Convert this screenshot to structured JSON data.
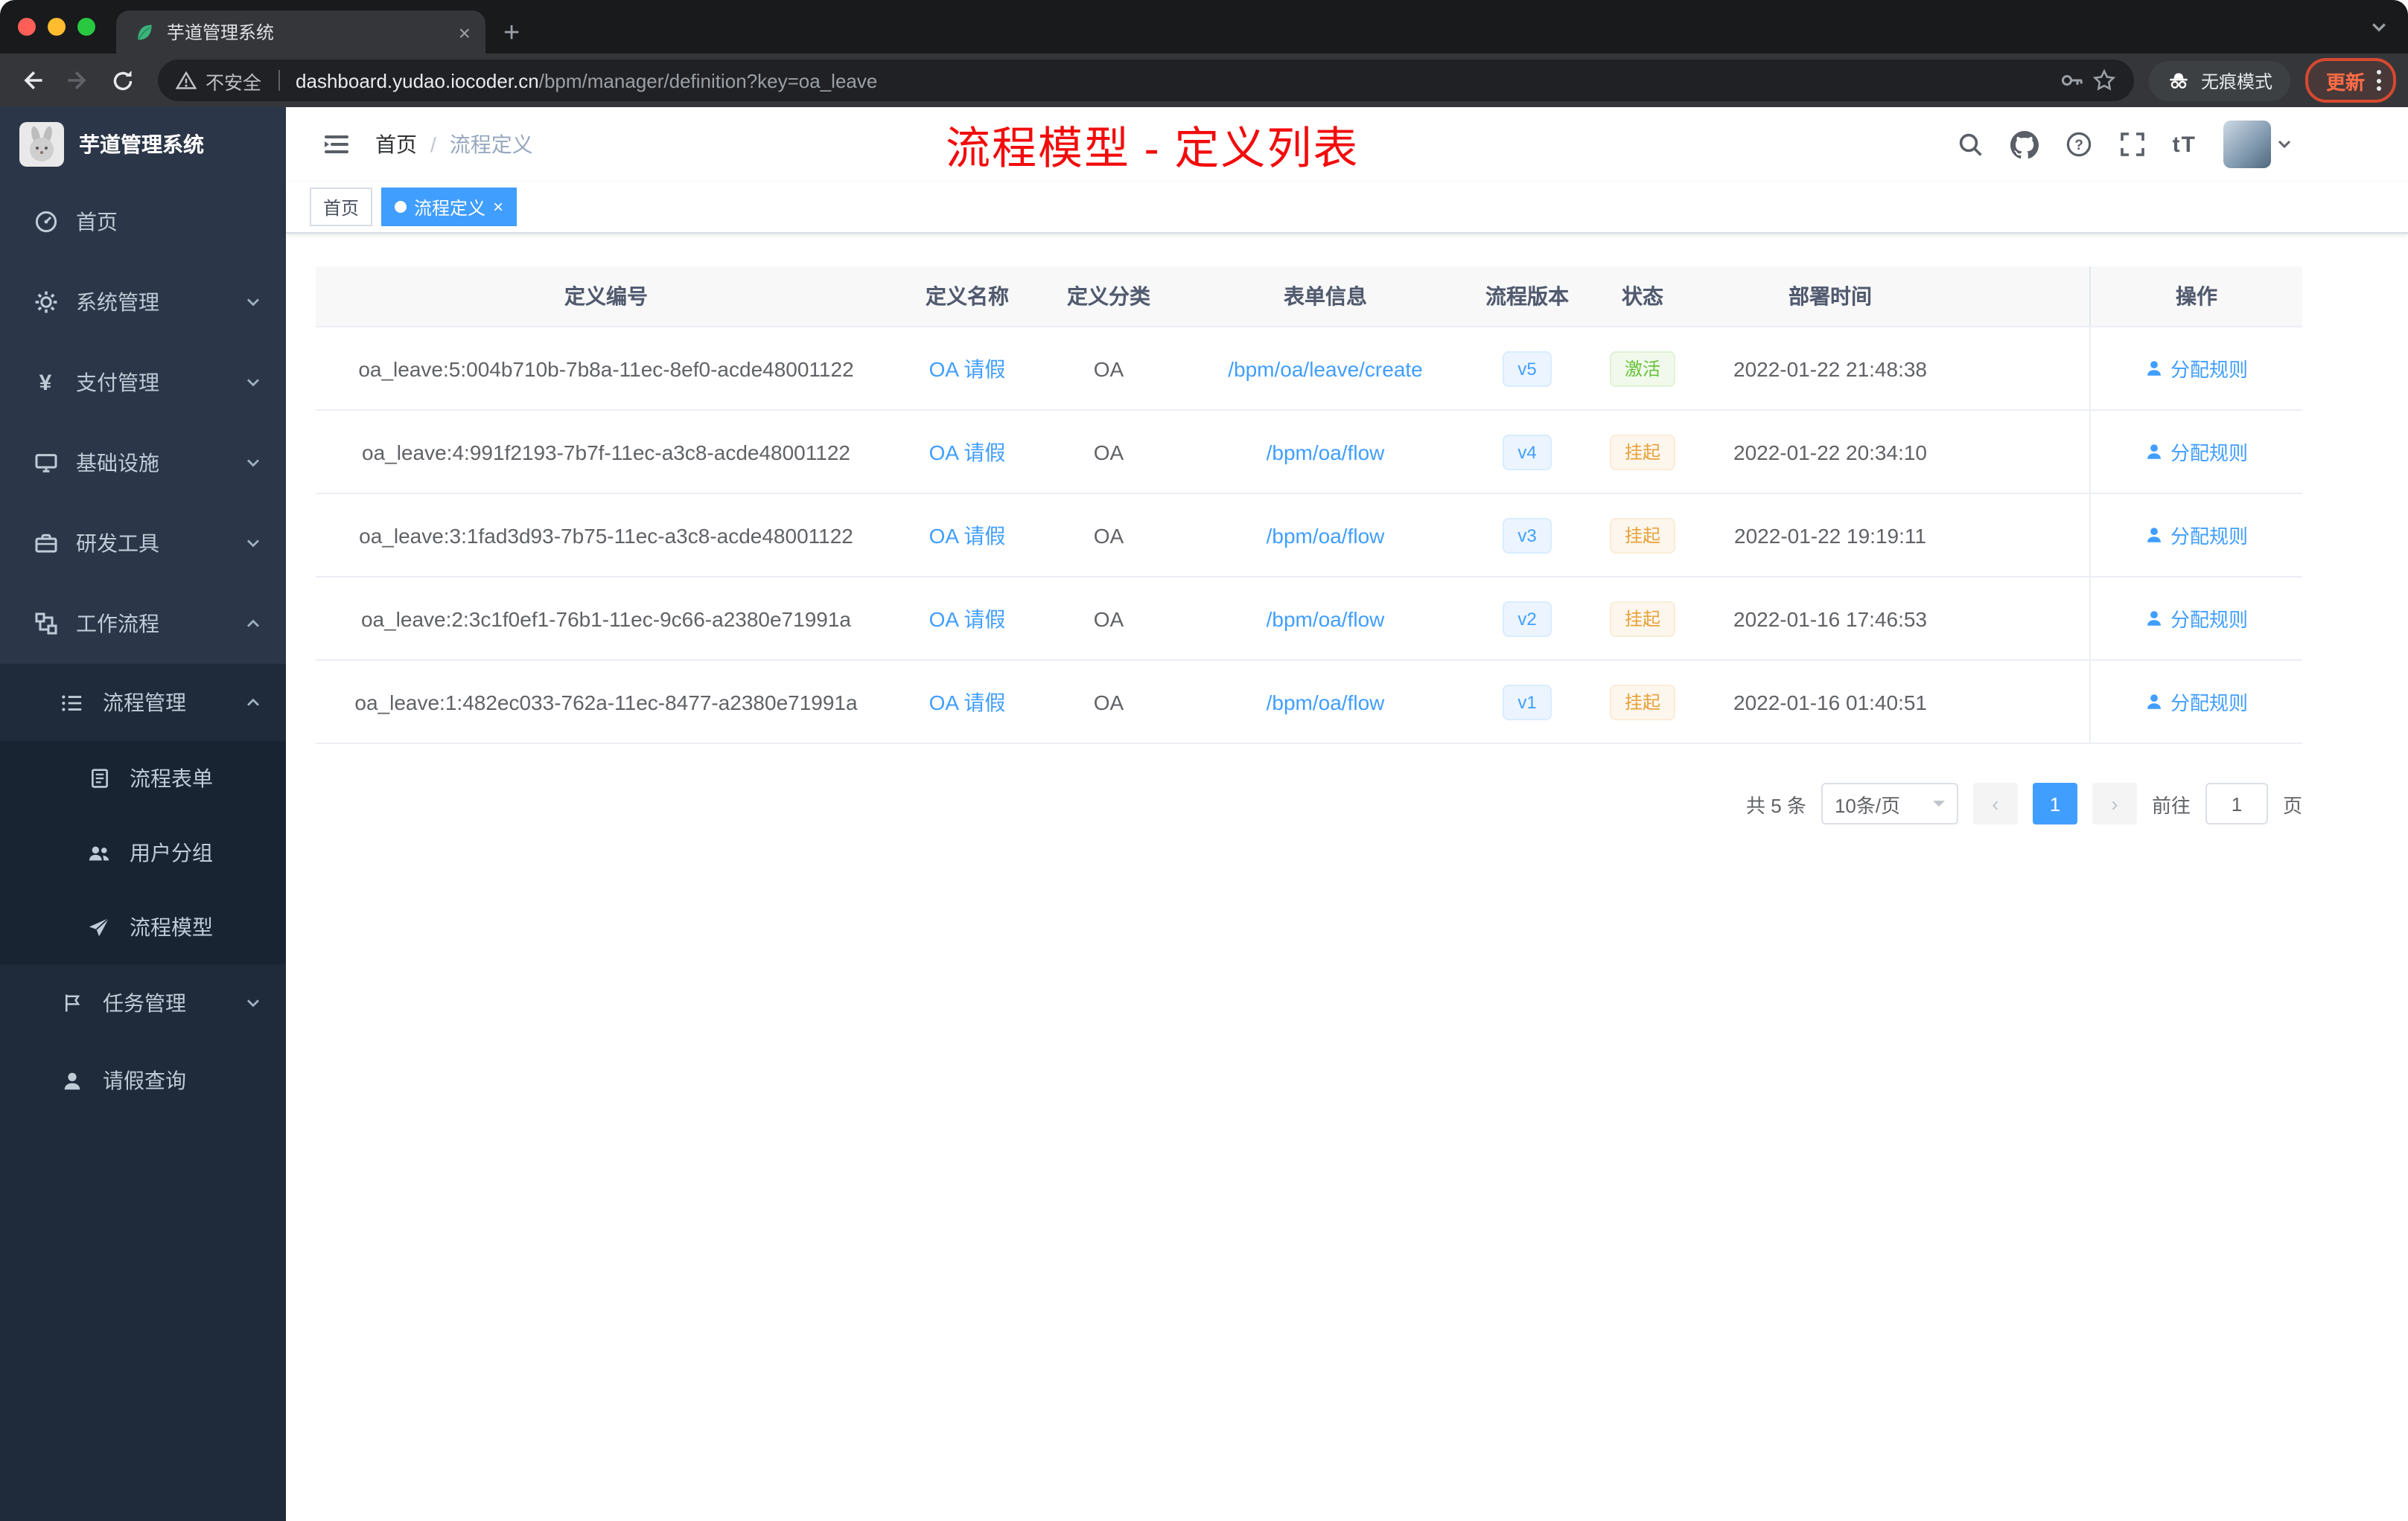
{
  "colors": {
    "primary": "#409eff",
    "annotation_red": "#f20c0c",
    "success_green": "#67c23a",
    "warning_orange": "#e6a23c",
    "sidebar_bg": "#2b3648"
  },
  "browser": {
    "tab_title": "芋道管理系统",
    "security": "不安全",
    "url_host": "dashboard.yudao.iocoder.cn",
    "url_path": "/bpm/manager/definition?key=oa_leave",
    "incognito": "无痕模式",
    "update": "更新"
  },
  "sidebar": {
    "title": "芋道管理系统",
    "menu": [
      {
        "label": "首页"
      },
      {
        "label": "系统管理"
      },
      {
        "label": "支付管理"
      },
      {
        "label": "基础设施"
      },
      {
        "label": "研发工具"
      },
      {
        "label": "工作流程"
      },
      {
        "label": "流程管理"
      },
      {
        "label": "流程表单"
      },
      {
        "label": "用户分组"
      },
      {
        "label": "流程模型"
      },
      {
        "label": "任务管理"
      },
      {
        "label": "请假查询"
      }
    ]
  },
  "navbar": {
    "breadcrumb_home": "首页",
    "breadcrumb_sep": "/",
    "breadcrumb_current": "流程定义",
    "annotation": "流程模型 - 定义列表"
  },
  "tags": {
    "items": [
      {
        "label": "首页"
      },
      {
        "label": "流程定义"
      }
    ]
  },
  "table": {
    "columns": [
      "定义编号",
      "定义名称",
      "定义分类",
      "表单信息",
      "流程版本",
      "状态",
      "部署时间",
      "操作"
    ],
    "rows": [
      {
        "id": "oa_leave:5:004b710b-7b8a-11ec-8ef0-acde48001122",
        "name": "OA 请假",
        "category": "OA",
        "form": "/bpm/oa/leave/create",
        "version": "v5",
        "status": "激活",
        "deployed": "2022-01-22 21:48:38",
        "action": "分配规则"
      },
      {
        "id": "oa_leave:4:991f2193-7b7f-11ec-a3c8-acde48001122",
        "name": "OA 请假",
        "category": "OA",
        "form": "/bpm/oa/flow",
        "version": "v4",
        "status": "挂起",
        "deployed": "2022-01-22 20:34:10",
        "action": "分配规则"
      },
      {
        "id": "oa_leave:3:1fad3d93-7b75-11ec-a3c8-acde48001122",
        "name": "OA 请假",
        "category": "OA",
        "form": "/bpm/oa/flow",
        "version": "v3",
        "status": "挂起",
        "deployed": "2022-01-22 19:19:11",
        "action": "分配规则"
      },
      {
        "id": "oa_leave:2:3c1f0ef1-76b1-11ec-9c66-a2380e71991a",
        "name": "OA 请假",
        "category": "OA",
        "form": "/bpm/oa/flow",
        "version": "v2",
        "status": "挂起",
        "deployed": "2022-01-16 17:46:53",
        "action": "分配规则"
      },
      {
        "id": "oa_leave:1:482ec033-762a-11ec-8477-a2380e71991a",
        "name": "OA 请假",
        "category": "OA",
        "form": "/bpm/oa/flow",
        "version": "v1",
        "status": "挂起",
        "deployed": "2022-01-16 01:40:51",
        "action": "分配规则"
      }
    ]
  },
  "pagination": {
    "total": "共 5 条",
    "page_size": "10条/页",
    "page": "1",
    "goto_label": "前往",
    "goto_value": "1",
    "unit_label": "页"
  }
}
